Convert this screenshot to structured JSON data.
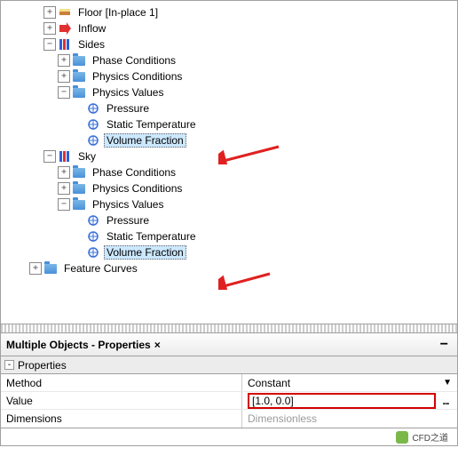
{
  "tree": {
    "floor": "Floor [In-place 1]",
    "inflow": "Inflow",
    "sides": "Sides",
    "sky": "Sky",
    "phase_cond": "Phase Conditions",
    "physics_cond": "Physics Conditions",
    "physics_val": "Physics Values",
    "pressure": "Pressure",
    "static_temp": "Static Temperature",
    "volume_fraction": "Volume Fraction",
    "feature_curves": "Feature Curves"
  },
  "props": {
    "panel_title": "Multiple Objects - Properties",
    "section": "Properties",
    "method_label": "Method",
    "method_value": "Constant",
    "value_label": "Value",
    "value_value": "[1.0, 0.0]",
    "dim_label": "Dimensions",
    "dim_value": "Dimensionless"
  },
  "watermark": "CFD之道"
}
